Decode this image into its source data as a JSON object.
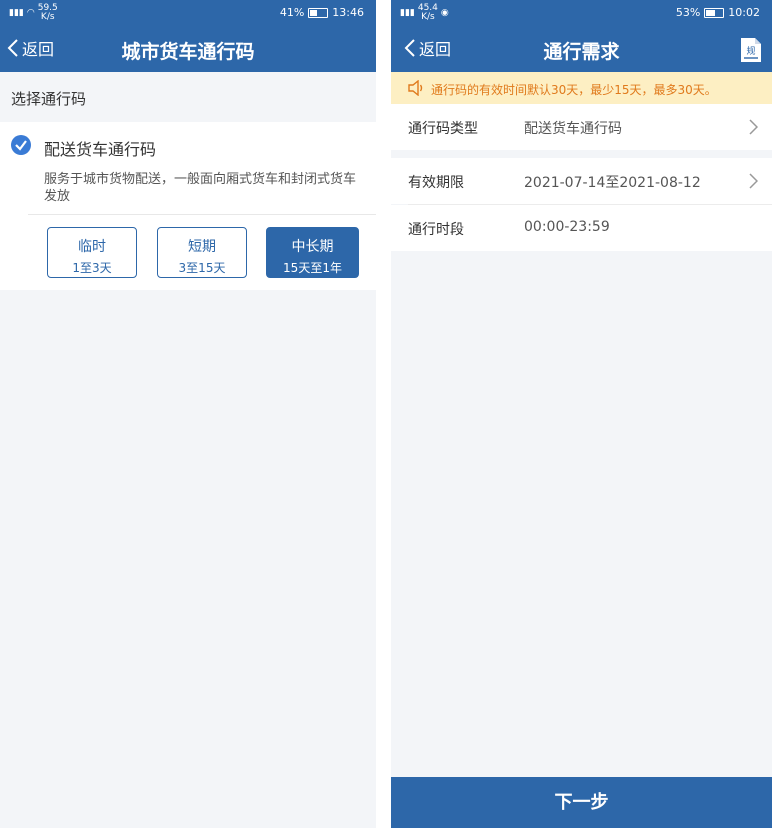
{
  "left": {
    "status": {
      "net": "59.5",
      "net_unit": "K/s",
      "battery": "41%",
      "time": "13:46"
    },
    "header": {
      "back_label": "返回",
      "title": "城市货车通行码"
    },
    "section_title": "选择通行码",
    "option": {
      "name": "配送货车通行码",
      "description": "服务于城市货物配送，一般面向厢式货车和封闭式货车发放"
    },
    "periods": [
      {
        "label": "临时",
        "range": "1至3天",
        "selected": false
      },
      {
        "label": "短期",
        "range": "3至15天",
        "selected": false
      },
      {
        "label": "中长期",
        "range": "15天至1年",
        "selected": true
      }
    ]
  },
  "right": {
    "status": {
      "net": "45.4",
      "net_unit": "K/s",
      "battery": "53%",
      "time": "10:02"
    },
    "header": {
      "back_label": "返回",
      "title": "通行需求",
      "doc_icon_char": "规"
    },
    "notice": "通行码的有效时间默认30天，最少15天，最多30天。",
    "rows": [
      {
        "key": "通行码类型",
        "value": "配送货车通行码"
      },
      {
        "key": "有效期限",
        "value": "2021-07-14至2021-08-12"
      },
      {
        "key": "通行时段",
        "value": "00:00-23:59"
      }
    ],
    "next_label": "下一步"
  },
  "colors": {
    "primary": "#2d67a9",
    "notice_bg": "#fdefc3",
    "notice_text": "#e07a1c",
    "check": "#3a7bd5"
  }
}
